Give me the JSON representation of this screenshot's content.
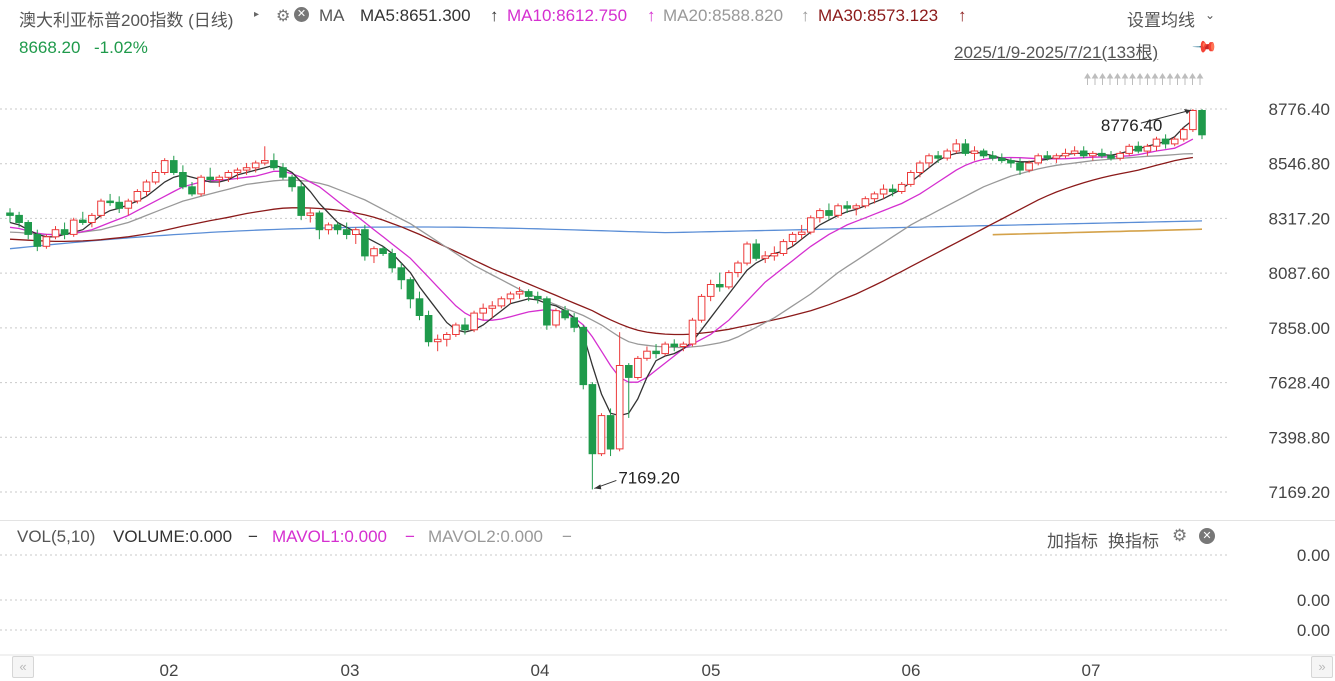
{
  "header": {
    "title": "澳大利亚标普200指数 (日线)",
    "ma_label": "MA",
    "ma5": "MA5:8651.300",
    "ma10": "MA10:8612.750",
    "ma20": "MA20:8588.820",
    "ma30": "MA30:8573.123",
    "arrow": "↑",
    "settings_link": "设置均线",
    "price": "8668.20",
    "change": "-1.02%",
    "date_range": "2025/1/9-2025/7/21(133根)"
  },
  "volume_header": {
    "vol": "VOL(5,10)",
    "volume": "VOLUME:0.000",
    "mavol1": "MAVOL1:0.000",
    "mavol2": "MAVOL2:0.000",
    "dash": "−",
    "add_indicator": "加指标",
    "switch_indicator": "换指标"
  },
  "colors": {
    "up": "#ec3a3a",
    "down": "#1f9a4b",
    "ma5": "#333333",
    "ma10": "#d52fd0",
    "ma20": "#999999",
    "ma30": "#8b1a1a",
    "long_ma_blue": "#5b8ed6",
    "long_ma_gold": "#d4a24a"
  },
  "chart_data": {
    "type": "candlestick",
    "price_axis_ticks": [
      "8776.40",
      "8546.80",
      "8317.20",
      "8087.60",
      "7858.00",
      "7628.40",
      "7398.80",
      "7169.20"
    ],
    "ylim": [
      7169.2,
      8776.4
    ],
    "volume_axis_ticks": [
      "0.00",
      "0.00",
      "0.00"
    ],
    "x_ticks": [
      "02",
      "03",
      "04",
      "05",
      "06",
      "07"
    ],
    "max_label": "8776.40",
    "min_label": "7169.20",
    "grid": true,
    "candles": [
      [
        8340,
        8360,
        8300,
        8330
      ],
      [
        8330,
        8345,
        8280,
        8300
      ],
      [
        8300,
        8310,
        8230,
        8250
      ],
      [
        8250,
        8270,
        8180,
        8200
      ],
      [
        8200,
        8250,
        8190,
        8240
      ],
      [
        8240,
        8285,
        8230,
        8270
      ],
      [
        8270,
        8300,
        8230,
        8250
      ],
      [
        8250,
        8320,
        8240,
        8310
      ],
      [
        8310,
        8345,
        8290,
        8300
      ],
      [
        8300,
        8340,
        8280,
        8330
      ],
      [
        8330,
        8400,
        8320,
        8390
      ],
      [
        8390,
        8420,
        8370,
        8385
      ],
      [
        8385,
        8410,
        8340,
        8360
      ],
      [
        8360,
        8400,
        8330,
        8390
      ],
      [
        8390,
        8440,
        8380,
        8430
      ],
      [
        8430,
        8480,
        8410,
        8470
      ],
      [
        8470,
        8520,
        8460,
        8510
      ],
      [
        8510,
        8570,
        8500,
        8560
      ],
      [
        8560,
        8580,
        8500,
        8510
      ],
      [
        8510,
        8540,
        8440,
        8450
      ],
      [
        8450,
        8470,
        8410,
        8420
      ],
      [
        8420,
        8500,
        8410,
        8490
      ],
      [
        8490,
        8530,
        8470,
        8480
      ],
      [
        8480,
        8500,
        8450,
        8490
      ],
      [
        8490,
        8520,
        8470,
        8510
      ],
      [
        8510,
        8530,
        8480,
        8520
      ],
      [
        8520,
        8550,
        8500,
        8530
      ],
      [
        8530,
        8560,
        8510,
        8550
      ],
      [
        8550,
        8620,
        8540,
        8560
      ],
      [
        8560,
        8590,
        8520,
        8530
      ],
      [
        8530,
        8550,
        8480,
        8490
      ],
      [
        8490,
        8500,
        8430,
        8450
      ],
      [
        8450,
        8470,
        8310,
        8330
      ],
      [
        8330,
        8360,
        8300,
        8340
      ],
      [
        8340,
        8350,
        8230,
        8270
      ],
      [
        8270,
        8300,
        8250,
        8290
      ],
      [
        8290,
        8300,
        8250,
        8270
      ],
      [
        8270,
        8300,
        8230,
        8250
      ],
      [
        8250,
        8280,
        8210,
        8270
      ],
      [
        8270,
        8290,
        8140,
        8160
      ],
      [
        8160,
        8200,
        8130,
        8190
      ],
      [
        8190,
        8200,
        8160,
        8170
      ],
      [
        8170,
        8190,
        8090,
        8110
      ],
      [
        8110,
        8130,
        8020,
        8060
      ],
      [
        8060,
        8070,
        7940,
        7980
      ],
      [
        7980,
        8010,
        7890,
        7910
      ],
      [
        7910,
        7930,
        7780,
        7800
      ],
      [
        7800,
        7830,
        7760,
        7810
      ],
      [
        7810,
        7840,
        7780,
        7830
      ],
      [
        7830,
        7880,
        7820,
        7870
      ],
      [
        7870,
        7900,
        7830,
        7850
      ],
      [
        7850,
        7930,
        7840,
        7920
      ],
      [
        7920,
        7960,
        7890,
        7940
      ],
      [
        7940,
        7970,
        7900,
        7950
      ],
      [
        7950,
        7990,
        7940,
        7980
      ],
      [
        7980,
        8010,
        7960,
        8000
      ],
      [
        8000,
        8030,
        7980,
        8010
      ],
      [
        8010,
        8020,
        7970,
        7990
      ],
      [
        7990,
        8010,
        7960,
        7980
      ],
      [
        7980,
        7990,
        7850,
        7870
      ],
      [
        7870,
        7940,
        7860,
        7930
      ],
      [
        7930,
        7950,
        7890,
        7900
      ],
      [
        7900,
        7920,
        7840,
        7860
      ],
      [
        7860,
        7870,
        7600,
        7620
      ],
      [
        7620,
        7630,
        7180,
        7330
      ],
      [
        7330,
        7500,
        7320,
        7490
      ],
      [
        7490,
        7520,
        7320,
        7350
      ],
      [
        7350,
        7840,
        7340,
        7700
      ],
      [
        7700,
        7710,
        7480,
        7650
      ],
      [
        7650,
        7740,
        7640,
        7730
      ],
      [
        7730,
        7780,
        7720,
        7760
      ],
      [
        7760,
        7790,
        7730,
        7750
      ],
      [
        7750,
        7800,
        7740,
        7790
      ],
      [
        7790,
        7810,
        7760,
        7780
      ],
      [
        7780,
        7800,
        7760,
        7790
      ],
      [
        7790,
        7900,
        7780,
        7890
      ],
      [
        7890,
        8000,
        7880,
        7990
      ],
      [
        7990,
        8060,
        7970,
        8040
      ],
      [
        8040,
        8090,
        8010,
        8030
      ],
      [
        8030,
        8100,
        8020,
        8090
      ],
      [
        8090,
        8140,
        8070,
        8130
      ],
      [
        8130,
        8220,
        8120,
        8210
      ],
      [
        8210,
        8230,
        8140,
        8150
      ],
      [
        8150,
        8180,
        8130,
        8160
      ],
      [
        8160,
        8200,
        8140,
        8170
      ],
      [
        8170,
        8230,
        8160,
        8220
      ],
      [
        8220,
        8260,
        8200,
        8250
      ],
      [
        8250,
        8290,
        8230,
        8260
      ],
      [
        8260,
        8330,
        8250,
        8320
      ],
      [
        8320,
        8360,
        8300,
        8350
      ],
      [
        8350,
        8380,
        8310,
        8330
      ],
      [
        8330,
        8380,
        8320,
        8370
      ],
      [
        8370,
        8390,
        8340,
        8360
      ],
      [
        8360,
        8380,
        8330,
        8370
      ],
      [
        8370,
        8410,
        8360,
        8400
      ],
      [
        8400,
        8430,
        8380,
        8420
      ],
      [
        8420,
        8460,
        8400,
        8440
      ],
      [
        8440,
        8460,
        8410,
        8430
      ],
      [
        8430,
        8470,
        8420,
        8460
      ],
      [
        8460,
        8520,
        8450,
        8510
      ],
      [
        8510,
        8560,
        8490,
        8550
      ],
      [
        8550,
        8590,
        8530,
        8580
      ],
      [
        8580,
        8600,
        8550,
        8570
      ],
      [
        8570,
        8610,
        8560,
        8600
      ],
      [
        8600,
        8650,
        8590,
        8630
      ],
      [
        8630,
        8650,
        8580,
        8590
      ],
      [
        8590,
        8620,
        8560,
        8600
      ],
      [
        8600,
        8610,
        8570,
        8580
      ],
      [
        8580,
        8600,
        8560,
        8570
      ],
      [
        8570,
        8590,
        8550,
        8560
      ],
      [
        8560,
        8570,
        8530,
        8550
      ],
      [
        8550,
        8570,
        8500,
        8520
      ],
      [
        8520,
        8560,
        8510,
        8550
      ],
      [
        8550,
        8590,
        8540,
        8580
      ],
      [
        8580,
        8600,
        8560,
        8570
      ],
      [
        8570,
        8590,
        8550,
        8580
      ],
      [
        8580,
        8610,
        8570,
        8590
      ],
      [
        8590,
        8620,
        8580,
        8600
      ],
      [
        8600,
        8620,
        8570,
        8580
      ],
      [
        8580,
        8600,
        8560,
        8590
      ],
      [
        8590,
        8610,
        8570,
        8580
      ],
      [
        8580,
        8600,
        8560,
        8570
      ],
      [
        8570,
        8600,
        8560,
        8590
      ],
      [
        8590,
        8630,
        8580,
        8620
      ],
      [
        8620,
        8640,
        8590,
        8600
      ],
      [
        8600,
        8630,
        8580,
        8620
      ],
      [
        8620,
        8660,
        8600,
        8650
      ],
      [
        8650,
        8670,
        8610,
        8630
      ],
      [
        8630,
        8660,
        8620,
        8650
      ],
      [
        8650,
        8700,
        8640,
        8690
      ],
      [
        8690,
        8776,
        8680,
        8770
      ],
      [
        8770,
        8776,
        8650,
        8668
      ]
    ],
    "ma5": [
      8300,
      8290,
      8270,
      8250,
      8240,
      8240,
      8250,
      8260,
      8270,
      8300,
      8330,
      8350,
      8360,
      8375,
      8390,
      8410,
      8440,
      8470,
      8490,
      8500,
      8490,
      8480,
      8470,
      8470,
      8480,
      8500,
      8510,
      8520,
      8530,
      8540,
      8530,
      8510,
      8470,
      8430,
      8380,
      8340,
      8300,
      8280,
      8260,
      8240,
      8220,
      8200,
      8170,
      8130,
      8090,
      8030,
      7980,
      7930,
      7880,
      7850,
      7840,
      7850,
      7870,
      7900,
      7930,
      7960,
      7970,
      7980,
      7975,
      7960,
      7950,
      7930,
      7900,
      7830,
      7700,
      7580,
      7500,
      7490,
      7500,
      7560,
      7650,
      7720,
      7740,
      7750,
      7770,
      7800,
      7850,
      7900,
      7950,
      8000,
      8050,
      8100,
      8130,
      8150,
      8170,
      8180,
      8200,
      8230,
      8260,
      8290,
      8310,
      8330,
      8345,
      8355,
      8370,
      8385,
      8400,
      8420,
      8440,
      8470,
      8500,
      8530,
      8560,
      8580,
      8590,
      8595,
      8595,
      8590,
      8580,
      8570,
      8560,
      8555,
      8555,
      8560,
      8565,
      8575,
      8585,
      8590,
      8590,
      8588,
      8585,
      8582,
      8590,
      8600,
      8610,
      8620,
      8630,
      8640,
      8660,
      8700,
      8730
    ],
    "ma10": [
      8280,
      8275,
      8265,
      8255,
      8250,
      8248,
      8250,
      8255,
      8262,
      8270,
      8285,
      8300,
      8315,
      8330,
      8350,
      8370,
      8390,
      8410,
      8430,
      8450,
      8460,
      8470,
      8475,
      8478,
      8480,
      8485,
      8490,
      8495,
      8505,
      8515,
      8515,
      8505,
      8490,
      8470,
      8450,
      8420,
      8390,
      8360,
      8330,
      8300,
      8270,
      8240,
      8210,
      8180,
      8150,
      8110,
      8070,
      8030,
      7990,
      7950,
      7920,
      7900,
      7890,
      7890,
      7895,
      7905,
      7915,
      7925,
      7930,
      7935,
      7930,
      7920,
      7900,
      7870,
      7820,
      7760,
      7700,
      7650,
      7630,
      7630,
      7650,
      7680,
      7710,
      7740,
      7770,
      7790,
      7810,
      7830,
      7860,
      7890,
      7930,
      7970,
      8010,
      8050,
      8080,
      8110,
      8140,
      8170,
      8200,
      8225,
      8250,
      8270,
      8290,
      8305,
      8320,
      8335,
      8350,
      8365,
      8380,
      8400,
      8420,
      8445,
      8470,
      8495,
      8520,
      8540,
      8555,
      8565,
      8570,
      8572,
      8573,
      8572,
      8570,
      8568,
      8567,
      8567,
      8568,
      8570,
      8572,
      8574,
      8575,
      8576,
      8578,
      8580,
      8585,
      8592,
      8600,
      8606,
      8612,
      8630,
      8650
    ],
    "ma20": [
      8260,
      8258,
      8255,
      8252,
      8250,
      8250,
      8252,
      8255,
      8260,
      8265,
      8270,
      8280,
      8290,
      8300,
      8315,
      8330,
      8345,
      8360,
      8375,
      8390,
      8400,
      8410,
      8420,
      8430,
      8440,
      8450,
      8460,
      8465,
      8470,
      8475,
      8478,
      8478,
      8476,
      8472,
      8465,
      8455,
      8440,
      8425,
      8410,
      8395,
      8375,
      8355,
      8335,
      8315,
      8295,
      8270,
      8245,
      8220,
      8195,
      8170,
      8145,
      8120,
      8100,
      8080,
      8060,
      8040,
      8020,
      8000,
      7985,
      7970,
      7955,
      7940,
      7925,
      7910,
      7890,
      7870,
      7845,
      7820,
      7800,
      7790,
      7785,
      7780,
      7778,
      7776,
      7775,
      7778,
      7782,
      7788,
      7795,
      7805,
      7820,
      7840,
      7860,
      7880,
      7900,
      7925,
      7950,
      7975,
      8000,
      8030,
      8060,
      8090,
      8115,
      8140,
      8165,
      8190,
      8215,
      8240,
      8265,
      8290,
      8310,
      8330,
      8350,
      8370,
      8390,
      8410,
      8430,
      8450,
      8465,
      8480,
      8495,
      8505,
      8515,
      8525,
      8533,
      8540,
      8545,
      8550,
      8555,
      8560,
      8563,
      8566,
      8569,
      8572,
      8575,
      8578,
      8580,
      8582,
      8585,
      8588,
      8589
    ],
    "ma30": [
      8230,
      8228,
      8226,
      8224,
      8222,
      8221,
      8221,
      8222,
      8223,
      8225,
      8228,
      8232,
      8236,
      8240,
      8246,
      8252,
      8260,
      8268,
      8276,
      8285,
      8292,
      8300,
      8308,
      8315,
      8322,
      8330,
      8338,
      8344,
      8350,
      8356,
      8360,
      8362,
      8362,
      8361,
      8359,
      8356,
      8352,
      8347,
      8340,
      8332,
      8322,
      8310,
      8296,
      8282,
      8266,
      8250,
      8232,
      8214,
      8196,
      8178,
      8160,
      8142,
      8124,
      8106,
      8090,
      8074,
      8058,
      8042,
      8026,
      8010,
      7994,
      7978,
      7962,
      7946,
      7930,
      7910,
      7892,
      7875,
      7860,
      7848,
      7840,
      7835,
      7832,
      7830,
      7830,
      7832,
      7836,
      7840,
      7846,
      7852,
      7860,
      7868,
      7876,
      7884,
      7892,
      7900,
      7910,
      7920,
      7930,
      7942,
      7955,
      7970,
      7985,
      8000,
      8018,
      8036,
      8055,
      8075,
      8095,
      8115,
      8135,
      8155,
      8175,
      8195,
      8215,
      8235,
      8255,
      8275,
      8295,
      8315,
      8335,
      8355,
      8375,
      8395,
      8412,
      8428,
      8442,
      8455,
      8467,
      8478,
      8488,
      8497,
      8505,
      8512,
      8520,
      8530,
      8540,
      8550,
      8560,
      8567,
      8573
    ]
  }
}
